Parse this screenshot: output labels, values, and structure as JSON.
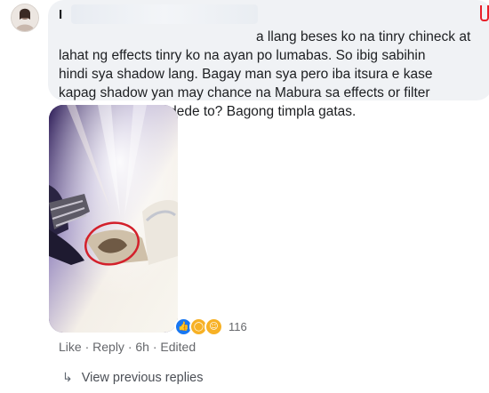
{
  "comment": {
    "author": "I",
    "text": "a llang beses ko na tinry chineck at\nlahat ng effects tinry ko na ayan po lumabas. So ibig sabihin\nhindi sya shadow lang. Bagay man sya pero iba itsura e kase\nkapag shadow yan may chance na Mabura sa effects or filter\nyan. batang dumededе to? Bagong timpla gatas."
  },
  "reactions": {
    "icons": [
      "like-icon",
      "wow-icon",
      "haha-icon"
    ],
    "count": "116"
  },
  "actions": {
    "like": "Like",
    "sep1": " · ",
    "reply": "Reply",
    "sep2": " · ",
    "time": "6h",
    "sep3": " · ",
    "edited": "Edited"
  },
  "replies": {
    "label": "View previous replies"
  },
  "colors": {
    "bubble": "#f0f2f5",
    "accent": "#1877f2",
    "circle": "#d3202b"
  }
}
